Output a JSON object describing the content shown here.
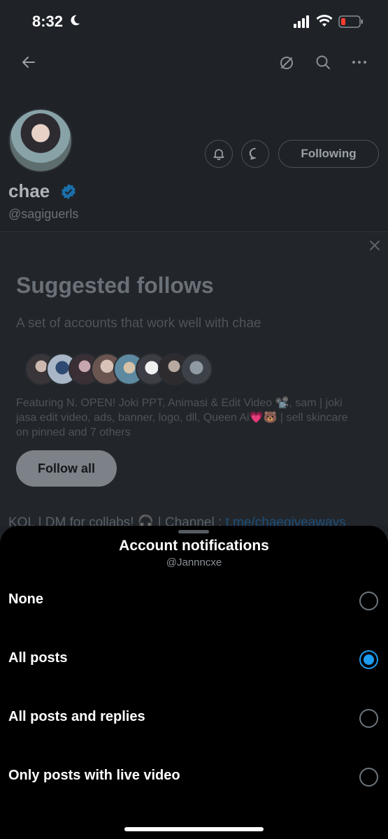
{
  "status_bar": {
    "time": "8:32"
  },
  "profile": {
    "name": "chae",
    "handle": "@sagiguerls",
    "following_label": "Following",
    "bio": "KOL | DM for collabs! 🎧 | Channel : ",
    "bio_link": "t.me/chaegiveaways"
  },
  "suggested": {
    "title": "Suggested follows",
    "subtitle": "A set of accounts that work well with chae",
    "featuring": "Featuring N. OPEN! Joki PPT, Animasi & Edit Video 📽️, sam | joki jasa edit video, ads, banner, logo, dll, Queen Ai💗🐻 | sell skincare on pinned and 7 others",
    "follow_all_label": "Follow all"
  },
  "sheet": {
    "title": "Account notifications",
    "subtitle": "@Jannncxe",
    "options": [
      {
        "label": "None",
        "selected": false
      },
      {
        "label": "All posts",
        "selected": true
      },
      {
        "label": "All posts and replies",
        "selected": false
      },
      {
        "label": "Only posts with live video",
        "selected": false
      }
    ]
  },
  "colors": {
    "accent": "#1d9bf0",
    "sheet_bg": "#000000",
    "page_bg": "#1f2328"
  }
}
